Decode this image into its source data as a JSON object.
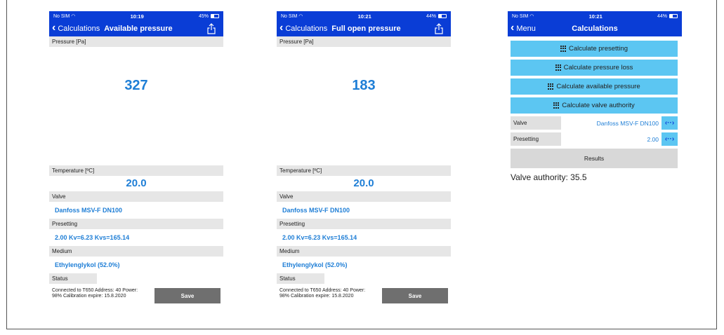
{
  "screens": [
    {
      "status": {
        "carrier": "No SIM",
        "time": "10:19",
        "battery": "45%",
        "battery_level": 0.45
      },
      "nav": {
        "back_label": "Calculations",
        "title": "Available pressure"
      },
      "pressure_label": "Pressure [Pa]",
      "pressure_value": "327",
      "temperature_label": "Temperature [ºC]",
      "temperature_value": "20.0",
      "valve_label": "Valve",
      "valve_value": "Danfoss MSV-F  DN100",
      "presetting_label": "Presetting",
      "presetting_value": "2.00 Kv=6.23 Kvs=165.14",
      "medium_label": "Medium",
      "medium_value": "Ethylenglykol (52.0%)",
      "status_label": "Status",
      "status_text": "Connected to T650 Address: 40 Power: 98% Calibration expire: 15.8.2020",
      "save_label": "Save"
    },
    {
      "status": {
        "carrier": "No SIM",
        "time": "10:21",
        "battery": "44%",
        "battery_level": 0.44
      },
      "nav": {
        "back_label": "Calculations",
        "title": "Full open pressure"
      },
      "pressure_label": "Pressure [Pa]",
      "pressure_value": "183",
      "temperature_label": "Temperature [ºC]",
      "temperature_value": "20.0",
      "valve_label": "Valve",
      "valve_value": "Danfoss MSV-F  DN100",
      "presetting_label": "Presetting",
      "presetting_value": "2.00 Kv=6.23 Kvs=165.14",
      "medium_label": "Medium",
      "medium_value": "Ethylenglykol (52.0%)",
      "status_label": "Status",
      "status_text": "Connected to T650 Address: 40 Power: 98% Calibration expire: 15.8.2020",
      "save_label": "Save"
    },
    {
      "status": {
        "carrier": "No SIM",
        "time": "10:21",
        "battery": "44%",
        "battery_level": 0.44
      },
      "nav": {
        "back_label": "Menu",
        "title": "Calculations"
      },
      "buttons": [
        "Calculate presetting",
        "Calculate pressure loss",
        "Calculate available pressure",
        "Calculate valve authority"
      ],
      "valve_label": "Valve",
      "valve_value": "Danfoss MSV-F  DN100",
      "presetting_label": "Presetting",
      "presetting_value": "2.00",
      "results_label": "Results",
      "authority_text": "Valve authority: 35.5"
    }
  ],
  "colors": {
    "nav_bar": "#0a3dd6",
    "accent_value": "#1e7ed6",
    "button": "#5cc6f2",
    "save": "#6f6f6f"
  },
  "icons": {
    "back": "chevron-left-icon",
    "share": "share-icon",
    "grid": "grid-icon",
    "swap": "swap-arrows-icon",
    "wifi": "wifi-icon",
    "battery": "battery-icon"
  }
}
